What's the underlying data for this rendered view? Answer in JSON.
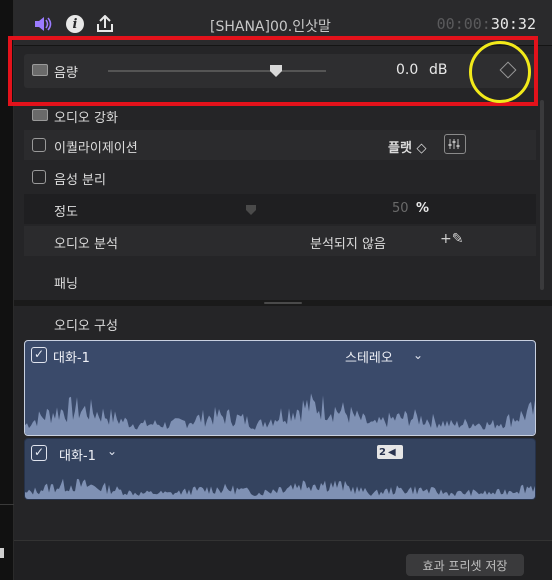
{
  "header": {
    "clip_title": "[SHANA]00.인삿말",
    "timecode_dim": "00:00:",
    "timecode_bright": "30:32",
    "icons": [
      "speaker-icon",
      "info-icon",
      "share-icon"
    ]
  },
  "volume": {
    "label": "음량",
    "value": "0.0",
    "unit": "dB",
    "icon": "keyframe-diamond-icon"
  },
  "sections": {
    "enhance_title": "오디오 강화",
    "equalization_label": "이퀄라이제이션",
    "equalization_value": "플랫 ◇",
    "voice_isolation_label": "음성 분리",
    "amount_label": "정도",
    "amount_value": "50",
    "amount_unit": "%",
    "analysis_label": "오디오 분석",
    "analysis_status": "분석되지 않음",
    "panning_label": "패닝"
  },
  "audio_config": {
    "title": "오디오 구성",
    "components": [
      {
        "name": "대화-1",
        "channel": "스테레오",
        "checked": true
      },
      {
        "name": "대화-1",
        "channel_badge": "2",
        "checked": true
      }
    ]
  },
  "footer": {
    "save_preset_label": "효과 프리셋 저장"
  },
  "colors": {
    "highlight_box": "#e3121b",
    "highlight_circle": "#f2ea1a",
    "audio_component": "#3a4a6a",
    "speaker_accent": "#9b7bff"
  }
}
